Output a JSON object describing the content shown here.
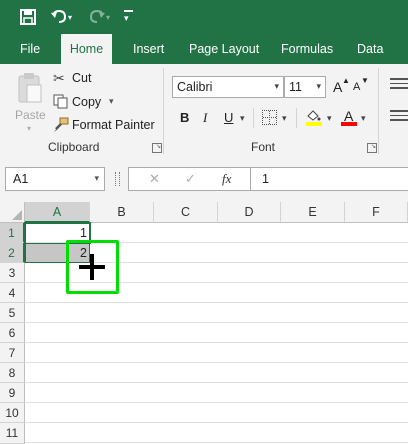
{
  "quick_access": {
    "save_icon": "save-icon",
    "undo_icon": "undo-icon",
    "redo_icon": "redo-icon",
    "customize_icon": "customize-qat-icon"
  },
  "tabs": [
    {
      "label": "File"
    },
    {
      "label": "Home"
    },
    {
      "label": "Insert"
    },
    {
      "label": "Page Layout"
    },
    {
      "label": "Formulas"
    },
    {
      "label": "Data"
    }
  ],
  "ribbon": {
    "clipboard": {
      "paste_label": "Paste",
      "cut_label": "Cut",
      "copy_label": "Copy",
      "format_painter_label": "Format Painter",
      "group_label": "Clipboard"
    },
    "font": {
      "font_name": "Calibri",
      "font_size": "11",
      "bold_label": "B",
      "italic_label": "I",
      "underline_label": "U",
      "grow_label": "A",
      "shrink_label": "A",
      "font_color_label": "A",
      "group_label": "Font",
      "colors": {
        "fill": "#ffff00",
        "font": "#ff0000"
      }
    }
  },
  "formula_bar": {
    "name_box": "A1",
    "cancel_symbol": "✕",
    "enter_symbol": "✓",
    "fx_label": "fx",
    "value": "1"
  },
  "grid": {
    "columns": [
      "A",
      "B",
      "C",
      "D",
      "E",
      "F"
    ],
    "rows": [
      "1",
      "2",
      "3",
      "4",
      "5",
      "6",
      "7",
      "8",
      "9",
      "10",
      "11"
    ],
    "cells": {
      "A1": "1",
      "A2": "2"
    },
    "selection_color": "#217346",
    "highlight_color": "#00dd00"
  }
}
